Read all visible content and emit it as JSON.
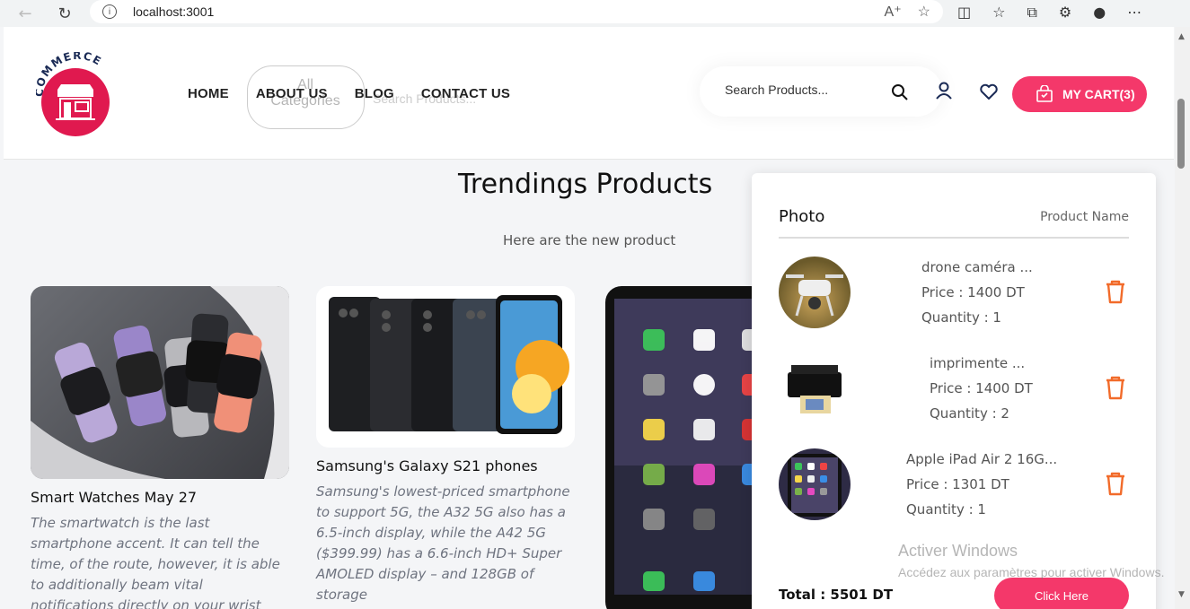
{
  "browser": {
    "url": "localhost:3001"
  },
  "header": {
    "logo_text": "COMMERCE",
    "nav": [
      "HOME",
      "ABOUT US",
      "BLOG",
      "CONTACT US"
    ],
    "category_ghost": "All Categories",
    "ghost_search": "Search Products...",
    "search_placeholder": "Search Products...",
    "cart_label": "MY CART(3)"
  },
  "trending": {
    "title": "Trendings Products",
    "subtitle": "Here are the new product",
    "cards": [
      {
        "title": "Smart Watches May 27",
        "desc": "The smartwatch is the last smartphone accent. It can tell the time, of the route, however, it is able to additionally beam vital notifications directly on your wrist"
      },
      {
        "title": "Samsung's Galaxy S21 phones",
        "desc": "Samsung's lowest-priced smartphone to support 5G, the A32 5G also has a 6.5-inch display, while the A42 5G ($399.99) has a 6.6-inch HD+ Super AMOLED display – and 128GB of storage"
      }
    ]
  },
  "cart": {
    "head_photo": "Photo",
    "head_name": "Product Name",
    "items": [
      {
        "name": "drone caméra ...",
        "price": "Price : 1400 DT",
        "qty": "Quantity : 1"
      },
      {
        "name": "imprimente ...",
        "price": "Price : 1400 DT",
        "qty": "Quantity : 2"
      },
      {
        "name": "Apple iPad Air 2 16G...",
        "price": "Price : 1301 DT",
        "qty": "Quantity : 1"
      }
    ],
    "total": "Total : 5501 DT",
    "button": "Click Here"
  },
  "watermark": {
    "line1": "Activer Windows",
    "line2": "Accédez aux paramètres pour activer Windows."
  },
  "colors": {
    "accent": "#f4386a",
    "trash": "#f26b2a"
  }
}
